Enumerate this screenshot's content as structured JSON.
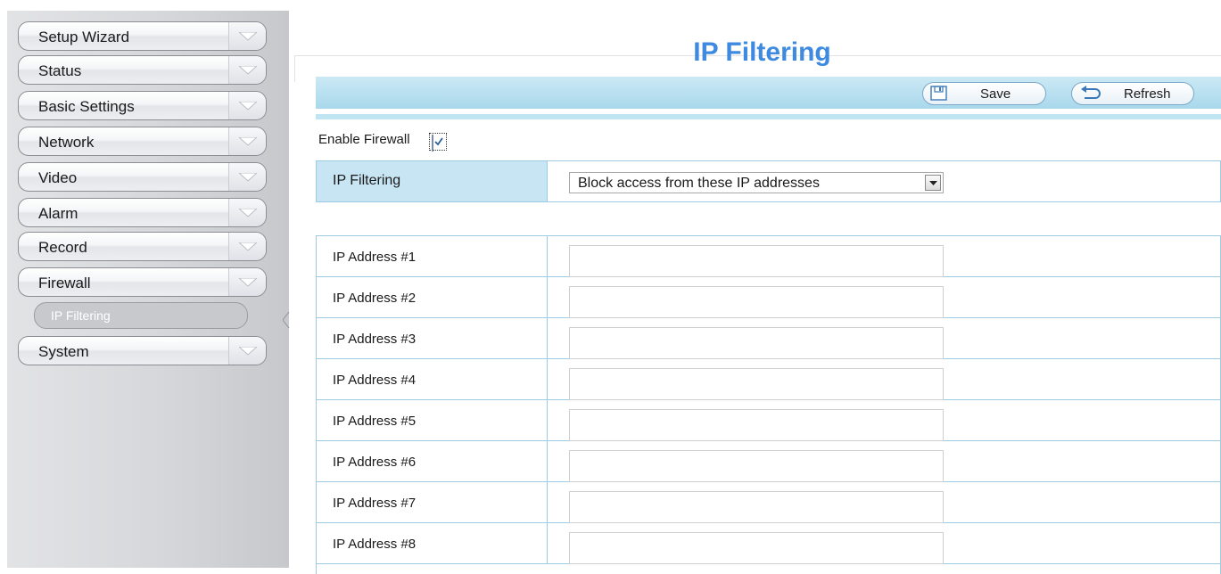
{
  "sidebar": {
    "items": [
      {
        "label": "Setup Wizard"
      },
      {
        "label": "Status"
      },
      {
        "label": "Basic Settings"
      },
      {
        "label": "Network"
      },
      {
        "label": "Video"
      },
      {
        "label": "Alarm"
      },
      {
        "label": "Record"
      },
      {
        "label": "Firewall"
      },
      {
        "label": "System"
      }
    ],
    "subitem": {
      "label": "IP Filtering"
    }
  },
  "page": {
    "title": "IP Filtering"
  },
  "toolbar": {
    "save_label": "Save",
    "refresh_label": "Refresh"
  },
  "firewall": {
    "label": "Enable Firewall",
    "checked": true
  },
  "filter": {
    "label": "IP Filtering",
    "selected": "Block access from these IP addresses"
  },
  "ip_rows": [
    {
      "label": "IP Address #1",
      "value": ""
    },
    {
      "label": "IP Address #2",
      "value": ""
    },
    {
      "label": "IP Address #3",
      "value": ""
    },
    {
      "label": "IP Address #4",
      "value": ""
    },
    {
      "label": "IP Address #5",
      "value": ""
    },
    {
      "label": "IP Address #6",
      "value": ""
    },
    {
      "label": "IP Address #7",
      "value": ""
    },
    {
      "label": "IP Address #8",
      "value": ""
    }
  ],
  "colors": {
    "title": "#3d8ae0",
    "toolbar": "#a9d8ec",
    "label_cell": "#c8e5f4"
  }
}
